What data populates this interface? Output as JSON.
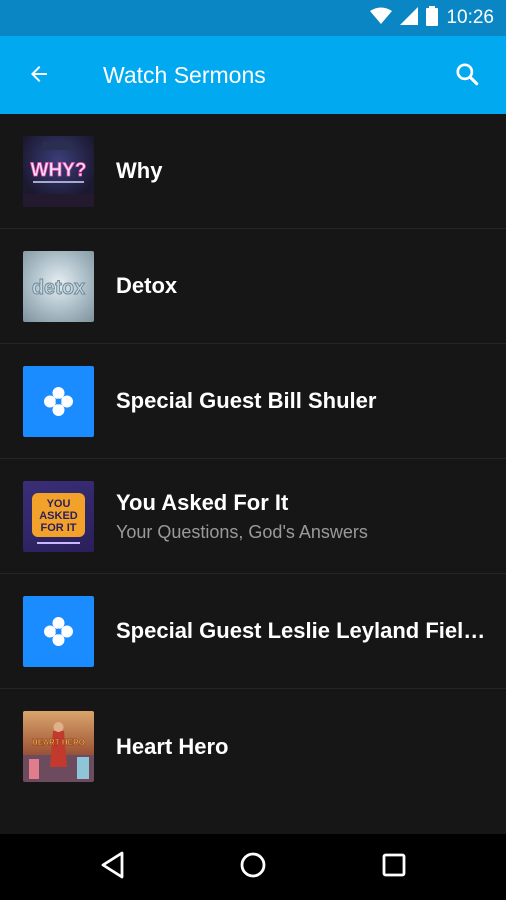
{
  "status_bar": {
    "time": "10:26",
    "icons": [
      "wifi-icon",
      "cell-signal-icon",
      "battery-icon"
    ]
  },
  "app_bar": {
    "title": "Watch Sermons",
    "back_icon": "arrow-back-icon",
    "search_icon": "search-icon",
    "background": "#00a9f0"
  },
  "sermons": [
    {
      "title": "Why",
      "subtitle": "",
      "thumb": "why-artwork"
    },
    {
      "title": "Detox",
      "subtitle": "",
      "thumb": "detox-artwork"
    },
    {
      "title": "Special Guest Bill Shuler",
      "subtitle": "",
      "thumb": "church-logo-icon"
    },
    {
      "title": "You Asked For It",
      "subtitle": "Your Questions, God's Answers",
      "thumb": "you-asked-for-it-artwork"
    },
    {
      "title": "Special Guest Leslie Leyland Fiel…",
      "subtitle": "",
      "thumb": "church-logo-icon"
    },
    {
      "title": "Heart Hero",
      "subtitle": "",
      "thumb": "heart-hero-artwork"
    }
  ],
  "thumb_art": {
    "why_text": "WHY?",
    "detox_text": "detox",
    "ysk_line1": "YOU",
    "ysk_line2": "ASKED",
    "ysk_line3": "FOR IT",
    "heart_hero_text": "HEART HERO"
  },
  "nav_bar": {
    "buttons": [
      "back-triangle-icon",
      "home-circle-icon",
      "recents-square-icon"
    ]
  },
  "colors": {
    "status_bar": "#0a86c4",
    "accent": "#00a9f0",
    "logo_tile": "#1a8cff",
    "background": "#161616"
  }
}
